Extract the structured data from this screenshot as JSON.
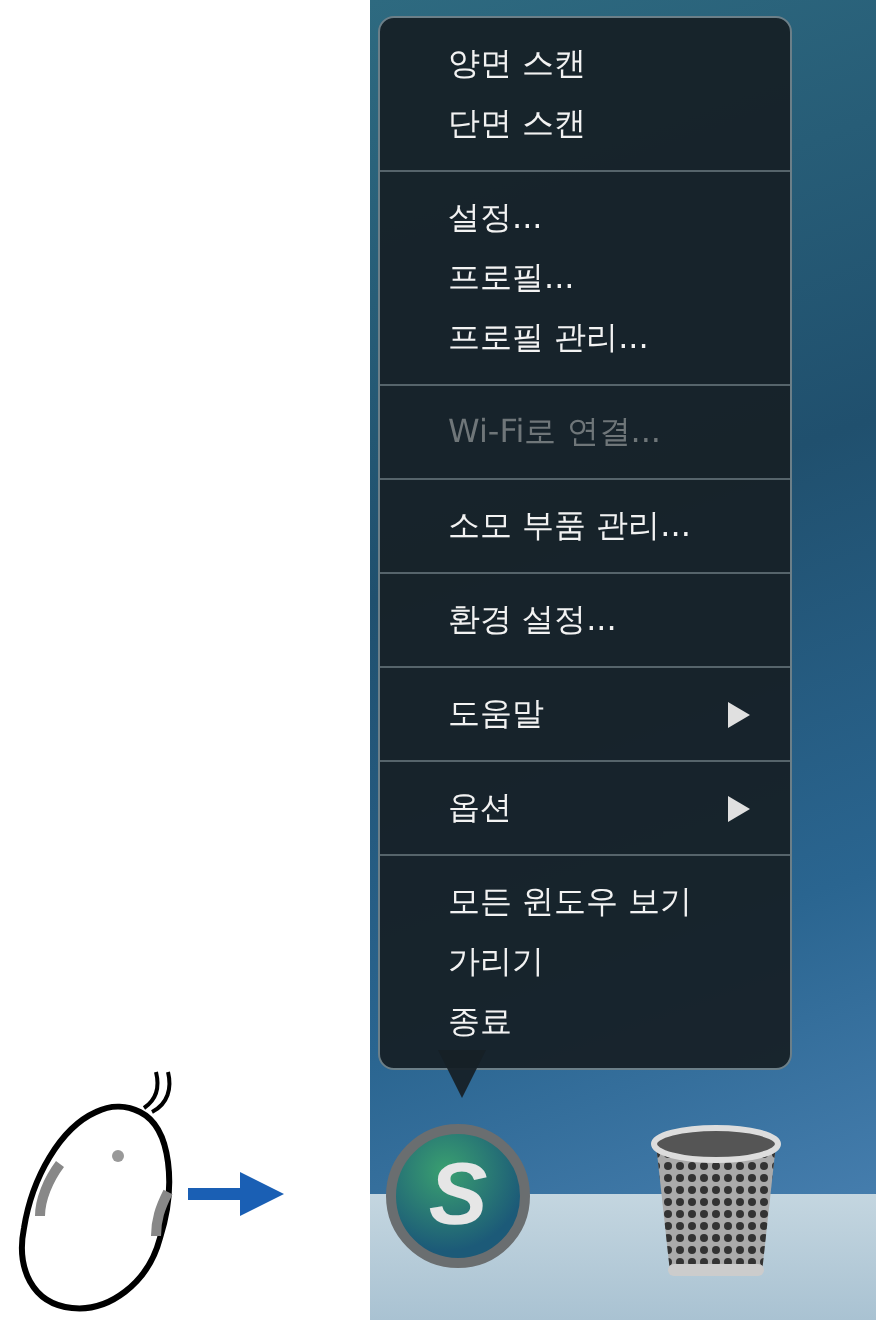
{
  "menu": {
    "groups": [
      {
        "items": [
          {
            "label": "양면 스캔",
            "disabled": false,
            "kind": "plain"
          },
          {
            "label": "단면 스캔",
            "disabled": false,
            "kind": "plain"
          }
        ]
      },
      {
        "items": [
          {
            "label": "설정...",
            "disabled": false,
            "kind": "plain"
          },
          {
            "label": "프로필...",
            "disabled": false,
            "kind": "plain"
          },
          {
            "label": "프로필 관리...",
            "disabled": false,
            "kind": "plain"
          }
        ]
      },
      {
        "items": [
          {
            "label": "Wi-Fi로 연결...",
            "disabled": true,
            "kind": "plain"
          }
        ]
      },
      {
        "items": [
          {
            "label": "소모 부품 관리...",
            "disabled": false,
            "kind": "plain"
          }
        ]
      },
      {
        "items": [
          {
            "label": "환경 설정...",
            "disabled": false,
            "kind": "plain"
          }
        ]
      },
      {
        "items": [
          {
            "label": "도움말",
            "disabled": false,
            "kind": "submenu"
          }
        ]
      },
      {
        "items": [
          {
            "label": "옵션",
            "disabled": false,
            "kind": "submenu"
          }
        ]
      },
      {
        "items": [
          {
            "label": "모든 윈도우 보기",
            "disabled": false,
            "kind": "plain"
          },
          {
            "label": "가리기",
            "disabled": false,
            "kind": "plain"
          },
          {
            "label": "종료",
            "disabled": false,
            "kind": "plain"
          }
        ]
      }
    ]
  },
  "dock": {
    "app_logo_letter": "S"
  }
}
